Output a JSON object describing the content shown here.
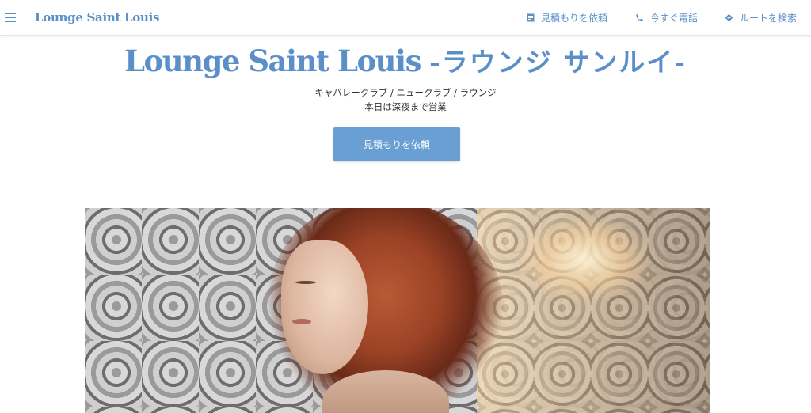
{
  "header": {
    "brand": "Lounge Saint Louis",
    "nav": [
      {
        "label": "見積もりを依頼",
        "icon": "document-icon"
      },
      {
        "label": "今すぐ電話",
        "icon": "phone-icon"
      },
      {
        "label": "ルートを検索",
        "icon": "directions-icon"
      }
    ]
  },
  "hero": {
    "title_en": "Lounge Saint Louis",
    "title_jp": "-ラウンジ サンルイ-",
    "categories": "キャバレークラブ / ニュークラブ / ラウンジ",
    "hours": "本日は深夜まで営業",
    "cta_label": "見積もりを依頼"
  },
  "colors": {
    "accent": "#5b8fc8",
    "button": "#6a9fd4"
  }
}
